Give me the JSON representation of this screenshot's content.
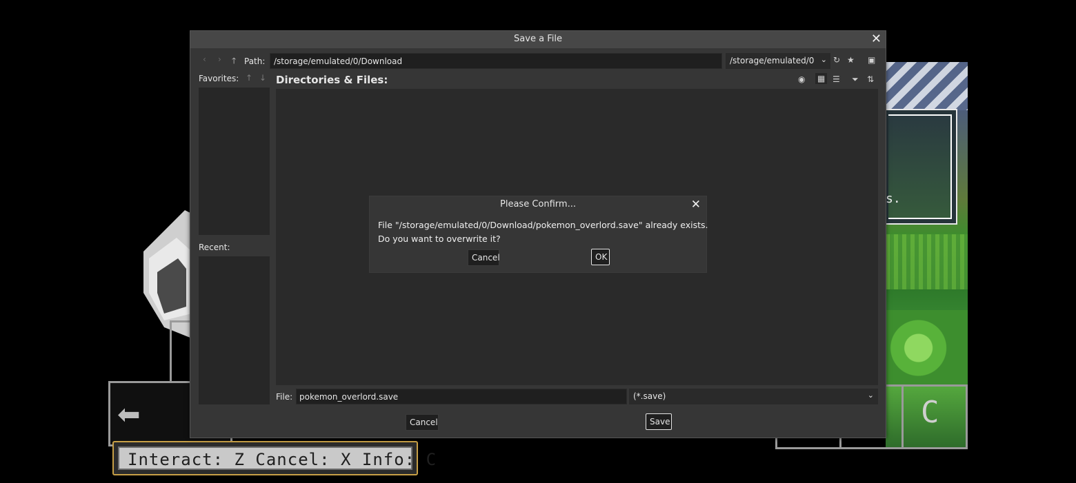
{
  "game": {
    "hud_text": "Interact: Z  Cancel: X  Info: C",
    "sign_text": "s.",
    "right_button_label": "C",
    "left_button_glyph": "⬅"
  },
  "dialog": {
    "title": "Save a File",
    "close_glyph": "✕",
    "toolbar": {
      "back_glyph": "‹",
      "forward_glyph": "›",
      "up_glyph": "🡑",
      "path_label": "Path:",
      "path_value": "/storage/emulated/0/Download",
      "drive_select": "/storage/emulated/0",
      "chevron": "⌄",
      "refresh_glyph": "↻",
      "favorite_glyph": "★",
      "new_folder_glyph": "▣"
    },
    "favorites": {
      "label": "Favorites:",
      "up_glyph": "↑",
      "down_glyph": "↓"
    },
    "recent": {
      "label": "Recent:"
    },
    "directories": {
      "label": "Directories & Files:",
      "hidden_toggle_glyph": "◉",
      "thumbnail_view_glyph": "▦",
      "list_view_glyph": "☰",
      "filter_glyph": "⏷",
      "sort_glyph": "⇅"
    },
    "file": {
      "label": "File:",
      "value": "pokemon_overlord.save",
      "filter": "(*.save)",
      "chevron": "⌄"
    },
    "buttons": {
      "cancel": "Cancel",
      "save": "Save"
    }
  },
  "confirm": {
    "title": "Please Confirm...",
    "close_glyph": "✕",
    "message_line1": "File \"/storage/emulated/0/Download/pokemon_overlord.save\" already exists.",
    "message_line2": "Do you want to overwrite it?",
    "cancel_label": "Cancel",
    "ok_label": "OK"
  },
  "colors": {
    "dialog_bg": "#363636",
    "titlebar_bg": "#474747",
    "input_bg": "#1f1f1f",
    "panel_bg": "#2a2a2a",
    "hud_border": "#c8a046"
  }
}
